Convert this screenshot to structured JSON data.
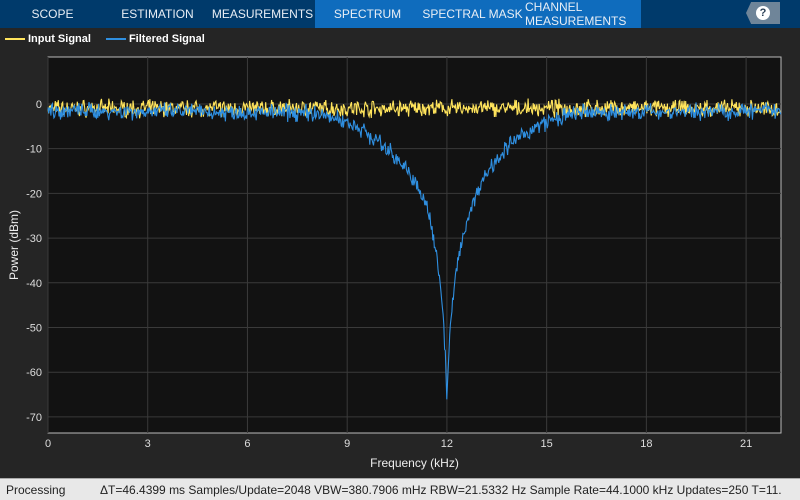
{
  "tabs": [
    {
      "label": "SCOPE",
      "style": "dark"
    },
    {
      "label": "ESTIMATION",
      "style": "dark"
    },
    {
      "label": "MEASUREMENTS",
      "style": "dark"
    },
    {
      "label": "SPECTRUM",
      "style": "light"
    },
    {
      "label": "SPECTRAL MASK",
      "style": "light"
    },
    {
      "label": "CHANNEL MEASUREMENTS",
      "style": "light"
    }
  ],
  "help_label": "?",
  "status": {
    "state": "Processing",
    "info": "ΔT=46.4399 ms  Samples/Update=2048  VBW=380.7906 mHz  RBW=21.5332 Hz  Sample Rate=44.1000 kHz  Updates=250  T=11."
  },
  "chart_data": {
    "type": "line",
    "title": "",
    "xlabel": "Frequency (kHz)",
    "ylabel": "Power (dBm)",
    "xlim": [
      0,
      22.05
    ],
    "ylim": [
      -73.6,
      10.5
    ],
    "xticks": [
      0,
      3,
      6,
      9,
      12,
      15,
      18,
      21
    ],
    "yticks": [
      0,
      -10,
      -20,
      -30,
      -40,
      -50,
      -60,
      -70
    ],
    "grid": true,
    "legend_position": "top-left",
    "series": [
      {
        "name": "Input Signal",
        "color": "#ffe45c",
        "noise_db": 1.6,
        "x": [
          0,
          22.05
        ],
        "y": [
          -1,
          -1
        ]
      },
      {
        "name": "Filtered Signal",
        "color": "#2f8fe0",
        "noise_db": 1.6,
        "x": [
          0,
          8,
          9,
          9.5,
          10,
          10.5,
          11,
          11.4,
          11.7,
          11.9,
          12,
          12.1,
          12.3,
          12.6,
          13,
          13.5,
          14,
          14.5,
          15,
          16,
          22.05
        ],
        "y": [
          -1.5,
          -2,
          -4,
          -6,
          -9,
          -12,
          -17,
          -23,
          -33,
          -48,
          -65,
          -50,
          -36,
          -26,
          -18,
          -12,
          -8.5,
          -6,
          -4,
          -2,
          -1.5
        ]
      }
    ]
  }
}
